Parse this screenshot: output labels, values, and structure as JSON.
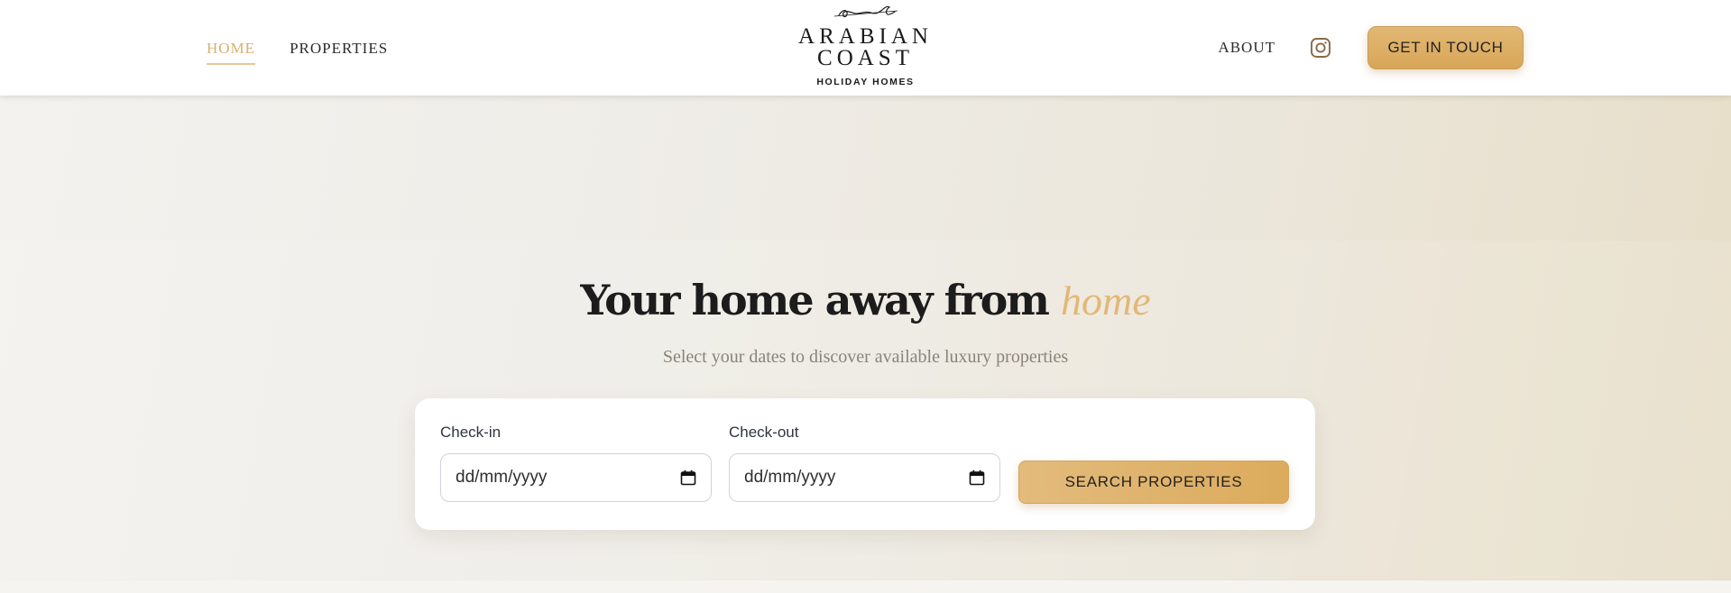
{
  "header": {
    "nav_left": [
      {
        "label": "HOME",
        "active": true
      },
      {
        "label": "PROPERTIES",
        "active": false
      }
    ],
    "logo": {
      "line1": "ARABIAN",
      "line2": "COAST",
      "subtitle": "HOLIDAY HOMES"
    },
    "about_label": "ABOUT",
    "instagram_icon": "instagram-icon",
    "cta_label": "GET IN TOUCH"
  },
  "hero": {
    "title_main": "Your home away from",
    "title_accent": "home",
    "subtitle": "Select your dates to discover available luxury properties"
  },
  "search": {
    "checkin_label": "Check-in",
    "checkin_value": "dd/mm/yyyy",
    "checkout_label": "Check-out",
    "checkout_value": "dd/mm/yyyy",
    "calendar_icon": "calendar-icon",
    "button_label": "SEARCH PROPERTIES"
  },
  "colors": {
    "accent": "#d9b070",
    "button_gold": "#dcab5c",
    "text_dark": "#1c1c1c"
  }
}
